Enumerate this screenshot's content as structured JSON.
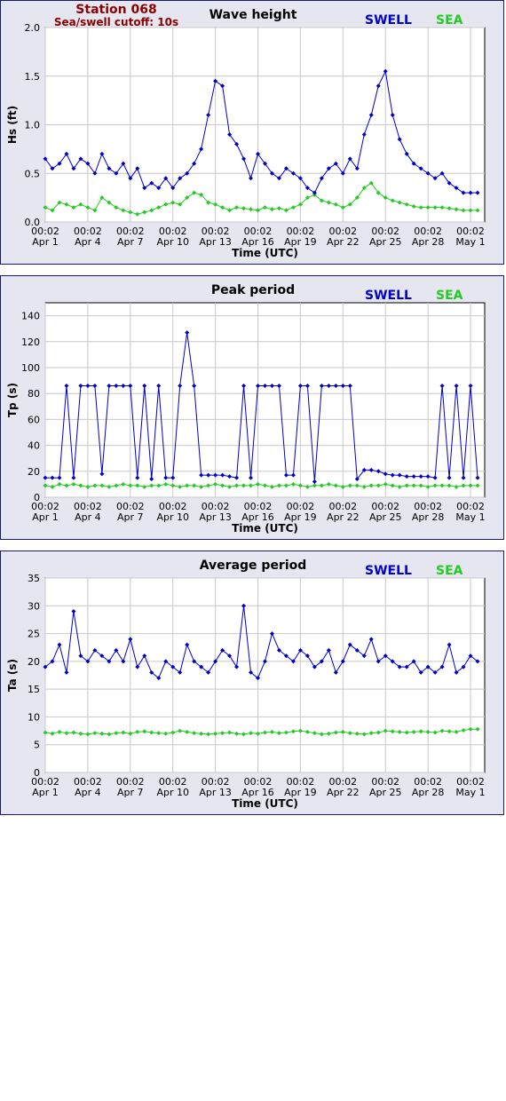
{
  "header": {
    "station": "Station 068",
    "cutoff": "Sea/swell cutoff: 10s"
  },
  "legend": {
    "swell": "SWELL",
    "sea": "SEA"
  },
  "colors": {
    "swell": "#0000cc",
    "sea": "#22cc22",
    "station": "#8b0000",
    "frame": "#1a1a6e"
  },
  "chart_data": [
    {
      "type": "line",
      "title": "Wave height",
      "xlabel": "Time (UTC)",
      "ylabel": "Hs (ft)",
      "ylim": [
        0,
        2.0
      ],
      "yticks": [
        "0.0",
        "0.5",
        "1.0",
        "1.5",
        "2.0"
      ],
      "xtick_times": [
        "00:02",
        "00:02",
        "00:02",
        "00:02",
        "00:02",
        "00:02",
        "00:02",
        "00:02",
        "00:02",
        "00:02",
        "00:02"
      ],
      "xtick_dates": [
        "Apr 1",
        "Apr 4",
        "Apr 7",
        "Apr 10",
        "Apr 13",
        "Apr 16",
        "Apr 19",
        "Apr 22",
        "Apr 25",
        "Apr 28",
        "May 1"
      ],
      "grid": true,
      "series": [
        {
          "name": "SWELL",
          "x": [
            0,
            0.5,
            1,
            1.5,
            2,
            2.5,
            3,
            3.5,
            4,
            4.5,
            5,
            5.5,
            6,
            6.5,
            7,
            7.5,
            8,
            8.5,
            9,
            9.5,
            10,
            10.5,
            11,
            11.5,
            12,
            12.5,
            13,
            13.5,
            14,
            14.5,
            15,
            15.5,
            16,
            16.5,
            17,
            17.5,
            18,
            18.5,
            19,
            19.5,
            20,
            20.5,
            21,
            21.5,
            22,
            22.5,
            23,
            23.5,
            24,
            24.5,
            25,
            25.5,
            26,
            26.5,
            27,
            27.5,
            28,
            28.5,
            29,
            29.5,
            30,
            30.5
          ],
          "values": [
            0.65,
            0.55,
            0.6,
            0.7,
            0.55,
            0.65,
            0.6,
            0.5,
            0.7,
            0.55,
            0.5,
            0.6,
            0.45,
            0.55,
            0.35,
            0.4,
            0.35,
            0.45,
            0.35,
            0.45,
            0.5,
            0.6,
            0.75,
            1.1,
            1.45,
            1.4,
            0.9,
            0.8,
            0.65,
            0.45,
            0.7,
            0.6,
            0.5,
            0.45,
            0.55,
            0.5,
            0.45,
            0.35,
            0.3,
            0.45,
            0.55,
            0.6,
            0.5,
            0.65,
            0.55,
            0.9,
            1.1,
            1.4,
            1.55,
            1.1,
            0.85,
            0.7,
            0.6,
            0.55,
            0.5,
            0.45,
            0.5,
            0.4,
            0.35,
            0.3,
            0.3,
            0.3
          ]
        },
        {
          "name": "SEA",
          "x": [
            0,
            0.5,
            1,
            1.5,
            2,
            2.5,
            3,
            3.5,
            4,
            4.5,
            5,
            5.5,
            6,
            6.5,
            7,
            7.5,
            8,
            8.5,
            9,
            9.5,
            10,
            10.5,
            11,
            11.5,
            12,
            12.5,
            13,
            13.5,
            14,
            14.5,
            15,
            15.5,
            16,
            16.5,
            17,
            17.5,
            18,
            18.5,
            19,
            19.5,
            20,
            20.5,
            21,
            21.5,
            22,
            22.5,
            23,
            23.5,
            24,
            24.5,
            25,
            25.5,
            26,
            26.5,
            27,
            27.5,
            28,
            28.5,
            29,
            29.5,
            30,
            30.5
          ],
          "values": [
            0.15,
            0.12,
            0.2,
            0.18,
            0.15,
            0.18,
            0.15,
            0.12,
            0.25,
            0.2,
            0.15,
            0.12,
            0.1,
            0.08,
            0.1,
            0.12,
            0.15,
            0.18,
            0.2,
            0.18,
            0.25,
            0.3,
            0.28,
            0.2,
            0.18,
            0.15,
            0.12,
            0.15,
            0.14,
            0.13,
            0.12,
            0.15,
            0.13,
            0.14,
            0.12,
            0.15,
            0.18,
            0.25,
            0.28,
            0.22,
            0.2,
            0.18,
            0.15,
            0.18,
            0.25,
            0.35,
            0.4,
            0.3,
            0.25,
            0.22,
            0.2,
            0.18,
            0.16,
            0.15,
            0.15,
            0.15,
            0.15,
            0.14,
            0.13,
            0.12,
            0.12,
            0.12
          ]
        }
      ]
    },
    {
      "type": "line",
      "title": "Peak period",
      "xlabel": "Time (UTC)",
      "ylabel": "Tp (s)",
      "ylim": [
        0,
        150
      ],
      "yticks": [
        "0",
        "20",
        "40",
        "60",
        "80",
        "100",
        "120",
        "140"
      ],
      "xtick_times": [
        "00:02",
        "00:02",
        "00:02",
        "00:02",
        "00:02",
        "00:02",
        "00:02",
        "00:02",
        "00:02",
        "00:02",
        "00:02"
      ],
      "xtick_dates": [
        "Apr 1",
        "Apr 4",
        "Apr 7",
        "Apr 10",
        "Apr 13",
        "Apr 16",
        "Apr 19",
        "Apr 22",
        "Apr 25",
        "Apr 28",
        "May 1"
      ],
      "grid": true,
      "series": [
        {
          "name": "SWELL",
          "x": [
            0,
            0.5,
            1,
            1.5,
            2,
            2.5,
            3,
            3.5,
            4,
            4.5,
            5,
            5.5,
            6,
            6.5,
            7,
            7.5,
            8,
            8.5,
            9,
            9.5,
            10,
            10.5,
            11,
            11.5,
            12,
            12.5,
            13,
            13.5,
            14,
            14.5,
            15,
            15.5,
            16,
            16.5,
            17,
            17.5,
            18,
            18.5,
            19,
            19.5,
            20,
            20.5,
            21,
            21.5,
            22,
            22.5,
            23,
            23.5,
            24,
            24.5,
            25,
            25.5,
            26,
            26.5,
            27,
            27.5,
            28,
            28.5,
            29,
            29.5,
            30,
            30.5
          ],
          "values": [
            15,
            15,
            15,
            86,
            15,
            86,
            86,
            86,
            18,
            86,
            86,
            86,
            86,
            15,
            86,
            14,
            86,
            15,
            15,
            86,
            127,
            86,
            17,
            17,
            17,
            17,
            16,
            15,
            86,
            15,
            86,
            86,
            86,
            86,
            17,
            17,
            86,
            86,
            12,
            86,
            86,
            86,
            86,
            86,
            14,
            21,
            21,
            20,
            18,
            17,
            17,
            16,
            16,
            16,
            16,
            15,
            86,
            15,
            86,
            15,
            86,
            15
          ]
        },
        {
          "name": "SEA",
          "x": [
            0,
            0.5,
            1,
            1.5,
            2,
            2.5,
            3,
            3.5,
            4,
            4.5,
            5,
            5.5,
            6,
            6.5,
            7,
            7.5,
            8,
            8.5,
            9,
            9.5,
            10,
            10.5,
            11,
            11.5,
            12,
            12.5,
            13,
            13.5,
            14,
            14.5,
            15,
            15.5,
            16,
            16.5,
            17,
            17.5,
            18,
            18.5,
            19,
            19.5,
            20,
            20.5,
            21,
            21.5,
            22,
            22.5,
            23,
            23.5,
            24,
            24.5,
            25,
            25.5,
            26,
            26.5,
            27,
            27.5,
            28,
            28.5,
            29,
            29.5,
            30,
            30.5
          ],
          "values": [
            9,
            8,
            10,
            9,
            10,
            9,
            8,
            9,
            9,
            8,
            9,
            10,
            9,
            9,
            8,
            9,
            9,
            10,
            9,
            8,
            9,
            9,
            8,
            9,
            10,
            9,
            8,
            9,
            9,
            9,
            10,
            9,
            8,
            9,
            9,
            10,
            9,
            8,
            9,
            9,
            10,
            9,
            8,
            9,
            9,
            8,
            9,
            9,
            10,
            9,
            8,
            9,
            9,
            9,
            8,
            9,
            9,
            9,
            8,
            9,
            9,
            9
          ]
        }
      ]
    },
    {
      "type": "line",
      "title": "Average period",
      "xlabel": "Time (UTC)",
      "ylabel": "Ta (s)",
      "ylim": [
        0,
        35
      ],
      "yticks": [
        "0",
        "5",
        "10",
        "15",
        "20",
        "25",
        "30",
        "35"
      ],
      "xtick_times": [
        "00:02",
        "00:02",
        "00:02",
        "00:02",
        "00:02",
        "00:02",
        "00:02",
        "00:02",
        "00:02",
        "00:02",
        "00:02"
      ],
      "xtick_dates": [
        "Apr 1",
        "Apr 4",
        "Apr 7",
        "Apr 10",
        "Apr 13",
        "Apr 16",
        "Apr 19",
        "Apr 22",
        "Apr 25",
        "Apr 28",
        "May 1"
      ],
      "grid": true,
      "series": [
        {
          "name": "SWELL",
          "x": [
            0,
            0.5,
            1,
            1.5,
            2,
            2.5,
            3,
            3.5,
            4,
            4.5,
            5,
            5.5,
            6,
            6.5,
            7,
            7.5,
            8,
            8.5,
            9,
            9.5,
            10,
            10.5,
            11,
            11.5,
            12,
            12.5,
            13,
            13.5,
            14,
            14.5,
            15,
            15.5,
            16,
            16.5,
            17,
            17.5,
            18,
            18.5,
            19,
            19.5,
            20,
            20.5,
            21,
            21.5,
            22,
            22.5,
            23,
            23.5,
            24,
            24.5,
            25,
            25.5,
            26,
            26.5,
            27,
            27.5,
            28,
            28.5,
            29,
            29.5,
            30,
            30.5
          ],
          "values": [
            19,
            20,
            23,
            18,
            29,
            21,
            20,
            22,
            21,
            20,
            22,
            20,
            24,
            19,
            21,
            18,
            17,
            20,
            19,
            18,
            23,
            20,
            19,
            18,
            20,
            22,
            21,
            19,
            30,
            18,
            17,
            20,
            25,
            22,
            21,
            20,
            22,
            21,
            19,
            20,
            22,
            18,
            20,
            23,
            22,
            21,
            24,
            20,
            21,
            20,
            19,
            19,
            20,
            18,
            19,
            18,
            19,
            23,
            18,
            19,
            21,
            20
          ]
        },
        {
          "name": "SEA",
          "x": [
            0,
            0.5,
            1,
            1.5,
            2,
            2.5,
            3,
            3.5,
            4,
            4.5,
            5,
            5.5,
            6,
            6.5,
            7,
            7.5,
            8,
            8.5,
            9,
            9.5,
            10,
            10.5,
            11,
            11.5,
            12,
            12.5,
            13,
            13.5,
            14,
            14.5,
            15,
            15.5,
            16,
            16.5,
            17,
            17.5,
            18,
            18.5,
            19,
            19.5,
            20,
            20.5,
            21,
            21.5,
            22,
            22.5,
            23,
            23.5,
            24,
            24.5,
            25,
            25.5,
            26,
            26.5,
            27,
            27.5,
            28,
            28.5,
            29,
            29.5,
            30,
            30.5
          ],
          "values": [
            7.2,
            7,
            7.3,
            7.1,
            7.2,
            7,
            6.9,
            7.1,
            7,
            6.9,
            7.1,
            7.2,
            7,
            7.3,
            7.4,
            7.2,
            7.1,
            7,
            7.2,
            7.5,
            7.3,
            7.1,
            7,
            6.9,
            7,
            7.1,
            7.2,
            7,
            6.9,
            7.1,
            7,
            7.2,
            7.3,
            7.1,
            7.2,
            7.4,
            7.5,
            7.3,
            7.1,
            6.9,
            7,
            7.2,
            7.3,
            7.1,
            7,
            6.9,
            7.1,
            7.2,
            7.5,
            7.4,
            7.3,
            7.2,
            7.3,
            7.4,
            7.3,
            7.2,
            7.5,
            7.4,
            7.3,
            7.6,
            7.8,
            7.8
          ]
        }
      ]
    }
  ]
}
